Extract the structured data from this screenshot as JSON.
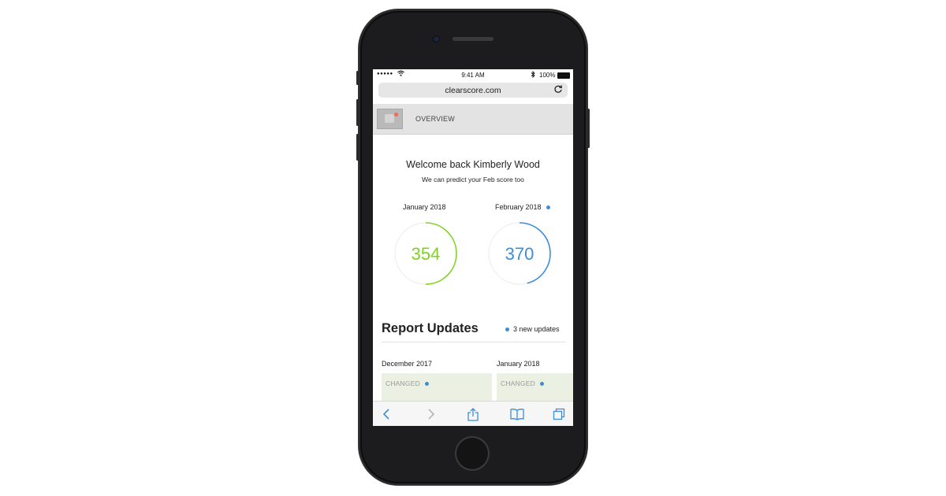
{
  "status_bar": {
    "signal": "●●●●●",
    "time": "9:41 AM",
    "battery": "100%"
  },
  "browser": {
    "url": "clearscore.com"
  },
  "nav": {
    "label": "OVERVIEW"
  },
  "welcome": {
    "title": "Welcome back Kimberly Wood",
    "subtitle": "We can predict your Feb score too"
  },
  "scores": [
    {
      "month": "January 2018",
      "value": "354",
      "color": "#7ed321",
      "progress": 0.5
    },
    {
      "month": "February 2018",
      "value": "370",
      "color": "#3d8ddb",
      "progress": 0.46
    }
  ],
  "report": {
    "title": "Report Updates",
    "updates": "3 new updates",
    "columns": [
      {
        "date": "December 2017",
        "status": "CHANGED"
      },
      {
        "date": "January 2018",
        "status": "CHANGED"
      }
    ]
  },
  "colors": {
    "green": "#7ed321",
    "blue": "#3d8ddb",
    "card_bg": "#eaf1e2",
    "nav_bg": "#e3e3e3"
  }
}
